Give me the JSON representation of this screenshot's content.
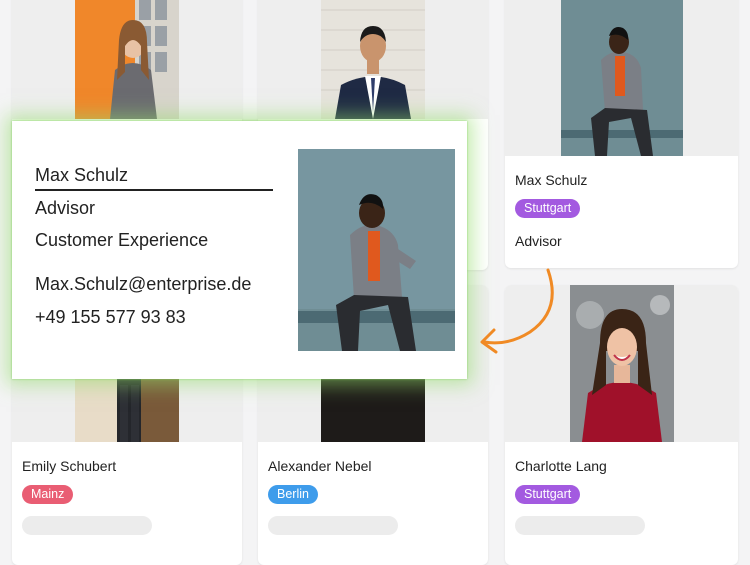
{
  "popup": {
    "name": "Max Schulz",
    "title": "Advisor",
    "department": "Customer Experience",
    "email": "Max.Schulz@enterprise.de",
    "phone": "+49 155 577 93 83"
  },
  "cards": [
    {
      "name": "",
      "tag": "",
      "tag_color": "",
      "role": ""
    },
    {
      "name": "",
      "tag": "",
      "tag_color": "",
      "role": ""
    },
    {
      "name": "Max Schulz",
      "tag": "Stuttgart",
      "tag_color": "#a35ae0",
      "role": "Advisor"
    },
    {
      "name": "Emily Schubert",
      "tag": "Mainz",
      "tag_color": "#e95d73",
      "role": ""
    },
    {
      "name": "Alexander Nebel",
      "tag": "Berlin",
      "tag_color": "#3e9ceb",
      "role": ""
    },
    {
      "name": "Charlotte Lang",
      "tag": "Stuttgart",
      "tag_color": "#a35ae0",
      "role": ""
    }
  ],
  "colors": {
    "accent_arrow": "#f08a24",
    "popup_glow": "#96dc6e"
  }
}
